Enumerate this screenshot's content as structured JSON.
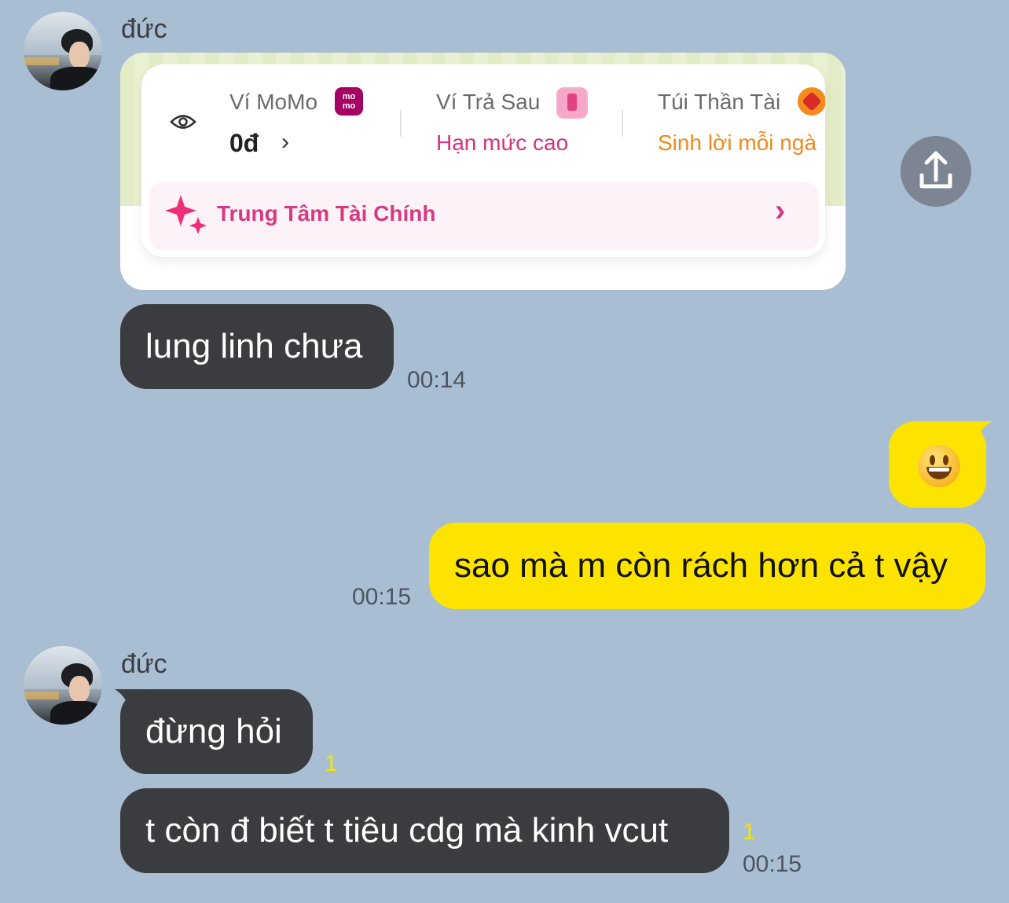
{
  "chat": {
    "sender_name_1": "đức",
    "sender_name_2": "đức",
    "card": {
      "wallet_label": "Ví MoMo",
      "wallet_value": "0đ",
      "wallet_chevron": "›",
      "paylater_label": "Ví Trả Sau",
      "paylater_value": "Hạn mức cao",
      "savings_label": "Túi Thần Tài",
      "savings_value": "Sinh lời mỗi ngà",
      "finance_center_label": "Trung Tâm Tài Chính",
      "finance_chevron": "›",
      "badge_momo_text": "mo mo",
      "accent_pink": "#d2337e",
      "accent_orange": "#f08a1b"
    },
    "messages": [
      {
        "text": "lung linh chưa",
        "time": "00:14"
      },
      {
        "text": "sao mà m còn rách hơn cả t vậy",
        "time": "00:15"
      },
      {
        "text": "đừng hỏi",
        "unread": "1"
      },
      {
        "text": "t còn đ biết t tiêu cdg mà kinh vcut",
        "unread": "1",
        "time": "00:15"
      }
    ],
    "icons": {
      "share": "share-upload-icon",
      "eye": "eye-icon",
      "sparkle": "sparkle-icon",
      "emoji": "smiley-face-emoji"
    },
    "colors": {
      "background": "#a9bed3",
      "incoming_bubble": "#3b3c3f",
      "outgoing_bubble": "#fde400"
    }
  }
}
